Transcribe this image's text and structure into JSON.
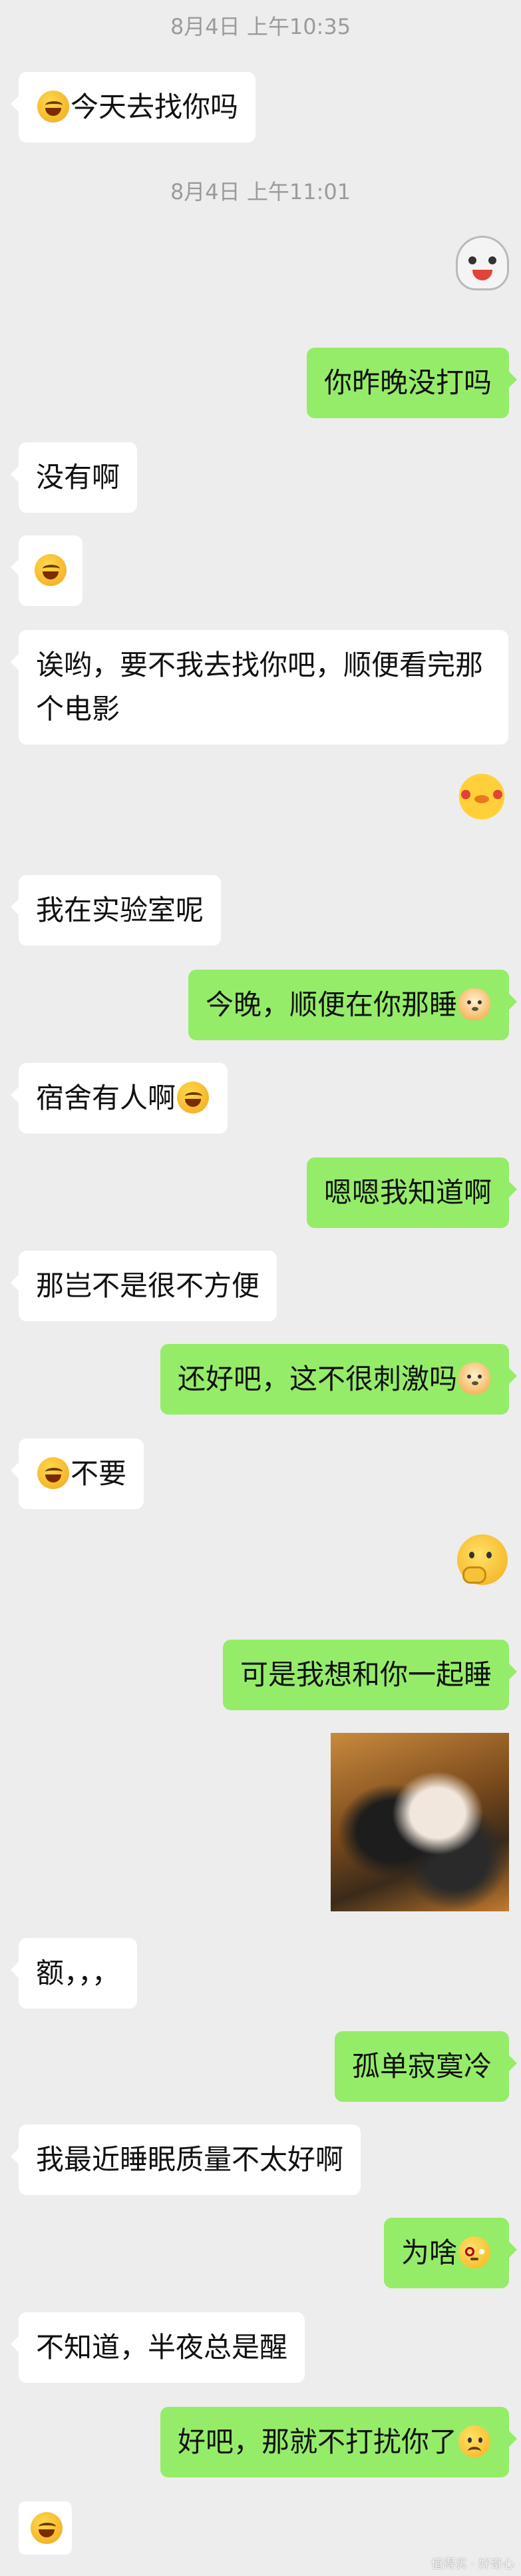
{
  "timestamps": [
    "8月4日 上午10:35",
    "8月4日 上午11:01"
  ],
  "messages": [
    {
      "text": "今天去找你吗"
    },
    {
      "text": "你昨晚没打吗"
    },
    {
      "text": "没有啊"
    },
    {
      "text": "诶哟，要不我去找你吧，顺便看完那个电影"
    },
    {
      "text": "我在实验室呢"
    },
    {
      "text": "今晚，顺便在你那睡"
    },
    {
      "text": "宿舍有人啊"
    },
    {
      "text": "嗯嗯我知道啊"
    },
    {
      "text": "那岂不是很不方便"
    },
    {
      "text": "还好吧，这不很刺激吗"
    },
    {
      "text": "不要"
    },
    {
      "text": "可是我想和你一起睡"
    },
    {
      "text": "额，，，"
    },
    {
      "text": "孤单寂寞冷"
    },
    {
      "text": "我最近睡眠质量不太好啊"
    },
    {
      "text": "为啥"
    },
    {
      "text": "不知道，半夜总是醒"
    },
    {
      "text": "好吧，那就不打扰你了"
    }
  ],
  "icons": {
    "laugh_cry": "laugh-cry-emoji",
    "doge": "doge-emoji",
    "angry": "angry-emoji",
    "sad": "sad-emoji",
    "cat_sticker": "cat-sticker",
    "chick_sticker": "chick-sticker",
    "thinking_sticker": "thinking-sticker",
    "dog_photo": "dog-photo-sticker"
  },
  "colors": {
    "background": "#ededed",
    "self_bubble": "#95ec69",
    "other_bubble": "#ffffff",
    "timestamp": "#9b9b9b"
  },
  "watermark": "值得买 · 好奇心"
}
